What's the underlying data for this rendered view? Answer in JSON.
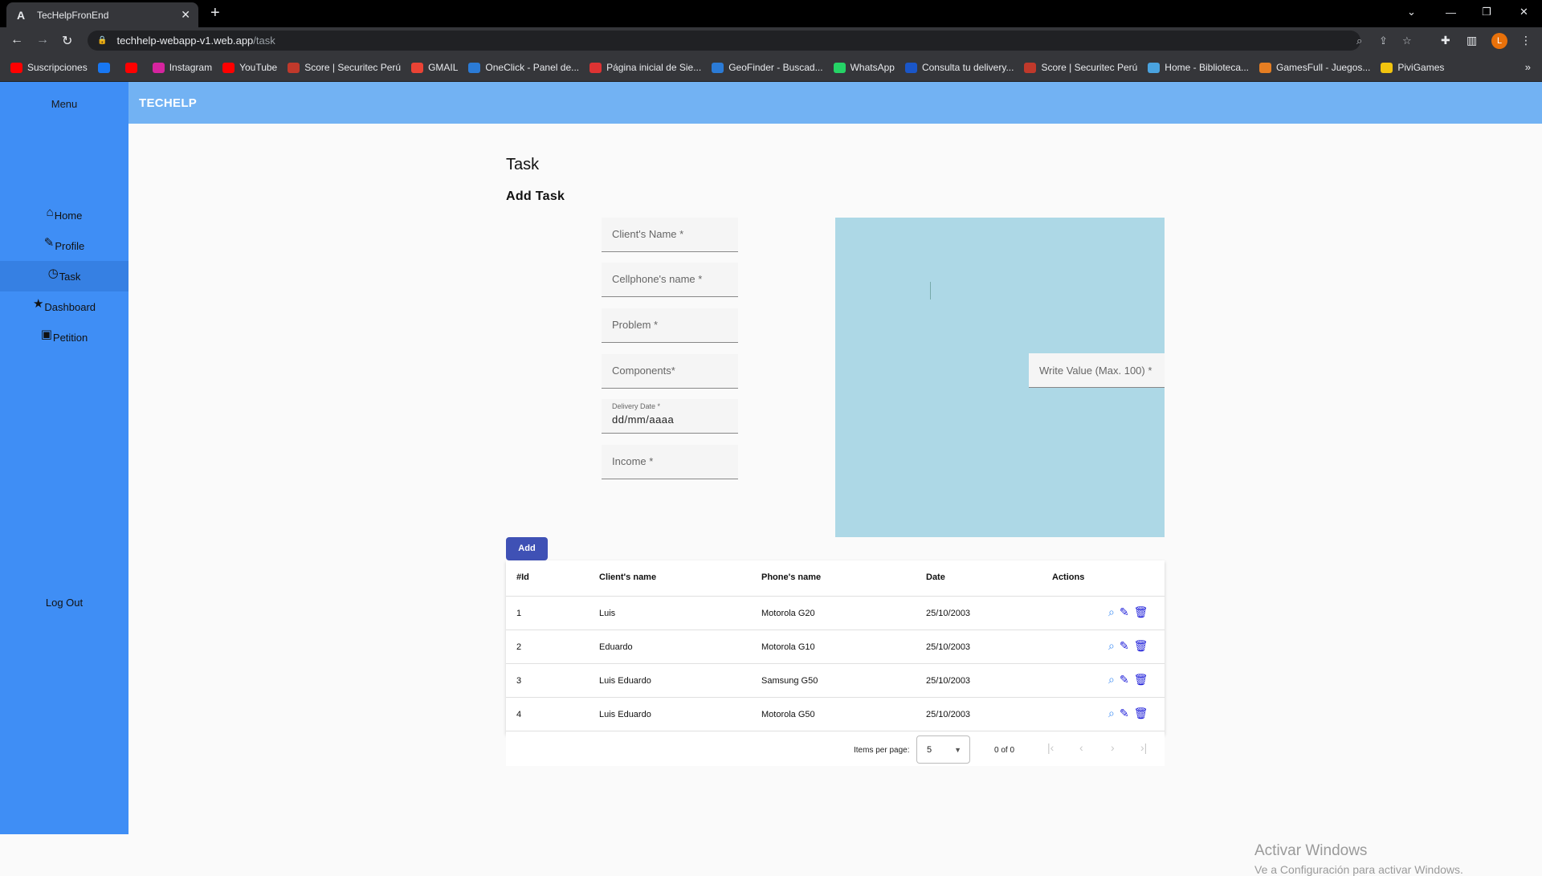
{
  "browser": {
    "tab_title": "TecHelpFronEnd",
    "url_host": "techhelp-webapp-v1.web.app",
    "url_path": "/task",
    "profile_initial": "L",
    "bookmarks": [
      {
        "label": "Suscripciones",
        "icon": "youtube-icon",
        "color": "#ff0000"
      },
      {
        "label": "",
        "icon": "facebook-icon",
        "color": "#1877f2"
      },
      {
        "label": "",
        "icon": "youtube-icon",
        "color": "#ff0000"
      },
      {
        "label": "Instagram",
        "icon": "instagram-icon",
        "color": "#d6249f"
      },
      {
        "label": "YouTube",
        "icon": "youtube-icon",
        "color": "#ff0000"
      },
      {
        "label": "Score | Securitec Perú",
        "icon": "score-icon",
        "color": "#c0392b"
      },
      {
        "label": "GMAIL",
        "icon": "gmail-icon",
        "color": "#ea4335"
      },
      {
        "label": "OneClick - Panel de...",
        "icon": "oneclick-icon",
        "color": "#2b7bd6"
      },
      {
        "label": "Página inicial de Sie...",
        "icon": "siebel-icon",
        "color": "#d33"
      },
      {
        "label": "GeoFinder - Buscad...",
        "icon": "map-pin-icon",
        "color": "#2b7bd6"
      },
      {
        "label": "WhatsApp",
        "icon": "whatsapp-icon",
        "color": "#25d366"
      },
      {
        "label": "Consulta tu delivery...",
        "icon": "delivery-icon",
        "color": "#1a56c8"
      },
      {
        "label": "Score | Securitec Perú",
        "icon": "score-icon",
        "color": "#c0392b"
      },
      {
        "label": "Home - Biblioteca...",
        "icon": "cloud-icon",
        "color": "#4aa3df"
      },
      {
        "label": "GamesFull - Juegos...",
        "icon": "games-icon",
        "color": "#e67e22"
      },
      {
        "label": "PiviGames",
        "icon": "pivigames-icon",
        "color": "#f1c40f"
      }
    ]
  },
  "sidebar": {
    "title": "Menu",
    "items": [
      {
        "label": "Home",
        "icon": "home-icon",
        "glyph": "⌂"
      },
      {
        "label": "Profile",
        "icon": "wrench-icon",
        "glyph": "🔧"
      },
      {
        "label": "Task",
        "icon": "clock-icon",
        "glyph": "◷"
      },
      {
        "label": "Dashboard",
        "icon": "star-icon",
        "glyph": "★"
      },
      {
        "label": "Petition",
        "icon": "inbox-icon",
        "glyph": "▣"
      }
    ],
    "logout": "Log Out"
  },
  "toolbar": {
    "brand": "TECHELP"
  },
  "page": {
    "title": "Task",
    "section": "Add Task"
  },
  "form": {
    "client_name": "Client's Name *",
    "cellphone_name": "Cellphone's name *",
    "problem": "Problem *",
    "components": "Components*",
    "delivery_label": "Delivery Date *",
    "delivery_value": "dd/mm/aaaa",
    "income": "Income *",
    "value_placeholder": "Write Value (Max. 100) *",
    "add_button": "Add"
  },
  "canvas": {
    "color": "#add8e6"
  },
  "table": {
    "headers": [
      "#Id",
      "Client's name",
      "Phone's name",
      "Date",
      "Actions"
    ],
    "rows": [
      {
        "id": "1",
        "client": "Luis",
        "phone": "Motorola G20",
        "date": "25/10/2003"
      },
      {
        "id": "2",
        "client": "Eduardo",
        "phone": "Motorola G10",
        "date": "25/10/2003"
      },
      {
        "id": "3",
        "client": "Luis Eduardo",
        "phone": "Samsung G50",
        "date": "25/10/2003"
      },
      {
        "id": "4",
        "client": "Luis Eduardo",
        "phone": "Motorola G50",
        "date": "25/10/2003"
      }
    ]
  },
  "paginator": {
    "items_per_page_label": "Items per page:",
    "page_size": "5",
    "range": "0 of 0"
  },
  "watermark": {
    "line1": "Activar Windows",
    "line2": "Ve a Configuración para activar Windows."
  },
  "colors": {
    "sidenav": "#3f8ef5",
    "toolbar": "#72b2f3",
    "primary_button": "#3f51b5"
  }
}
